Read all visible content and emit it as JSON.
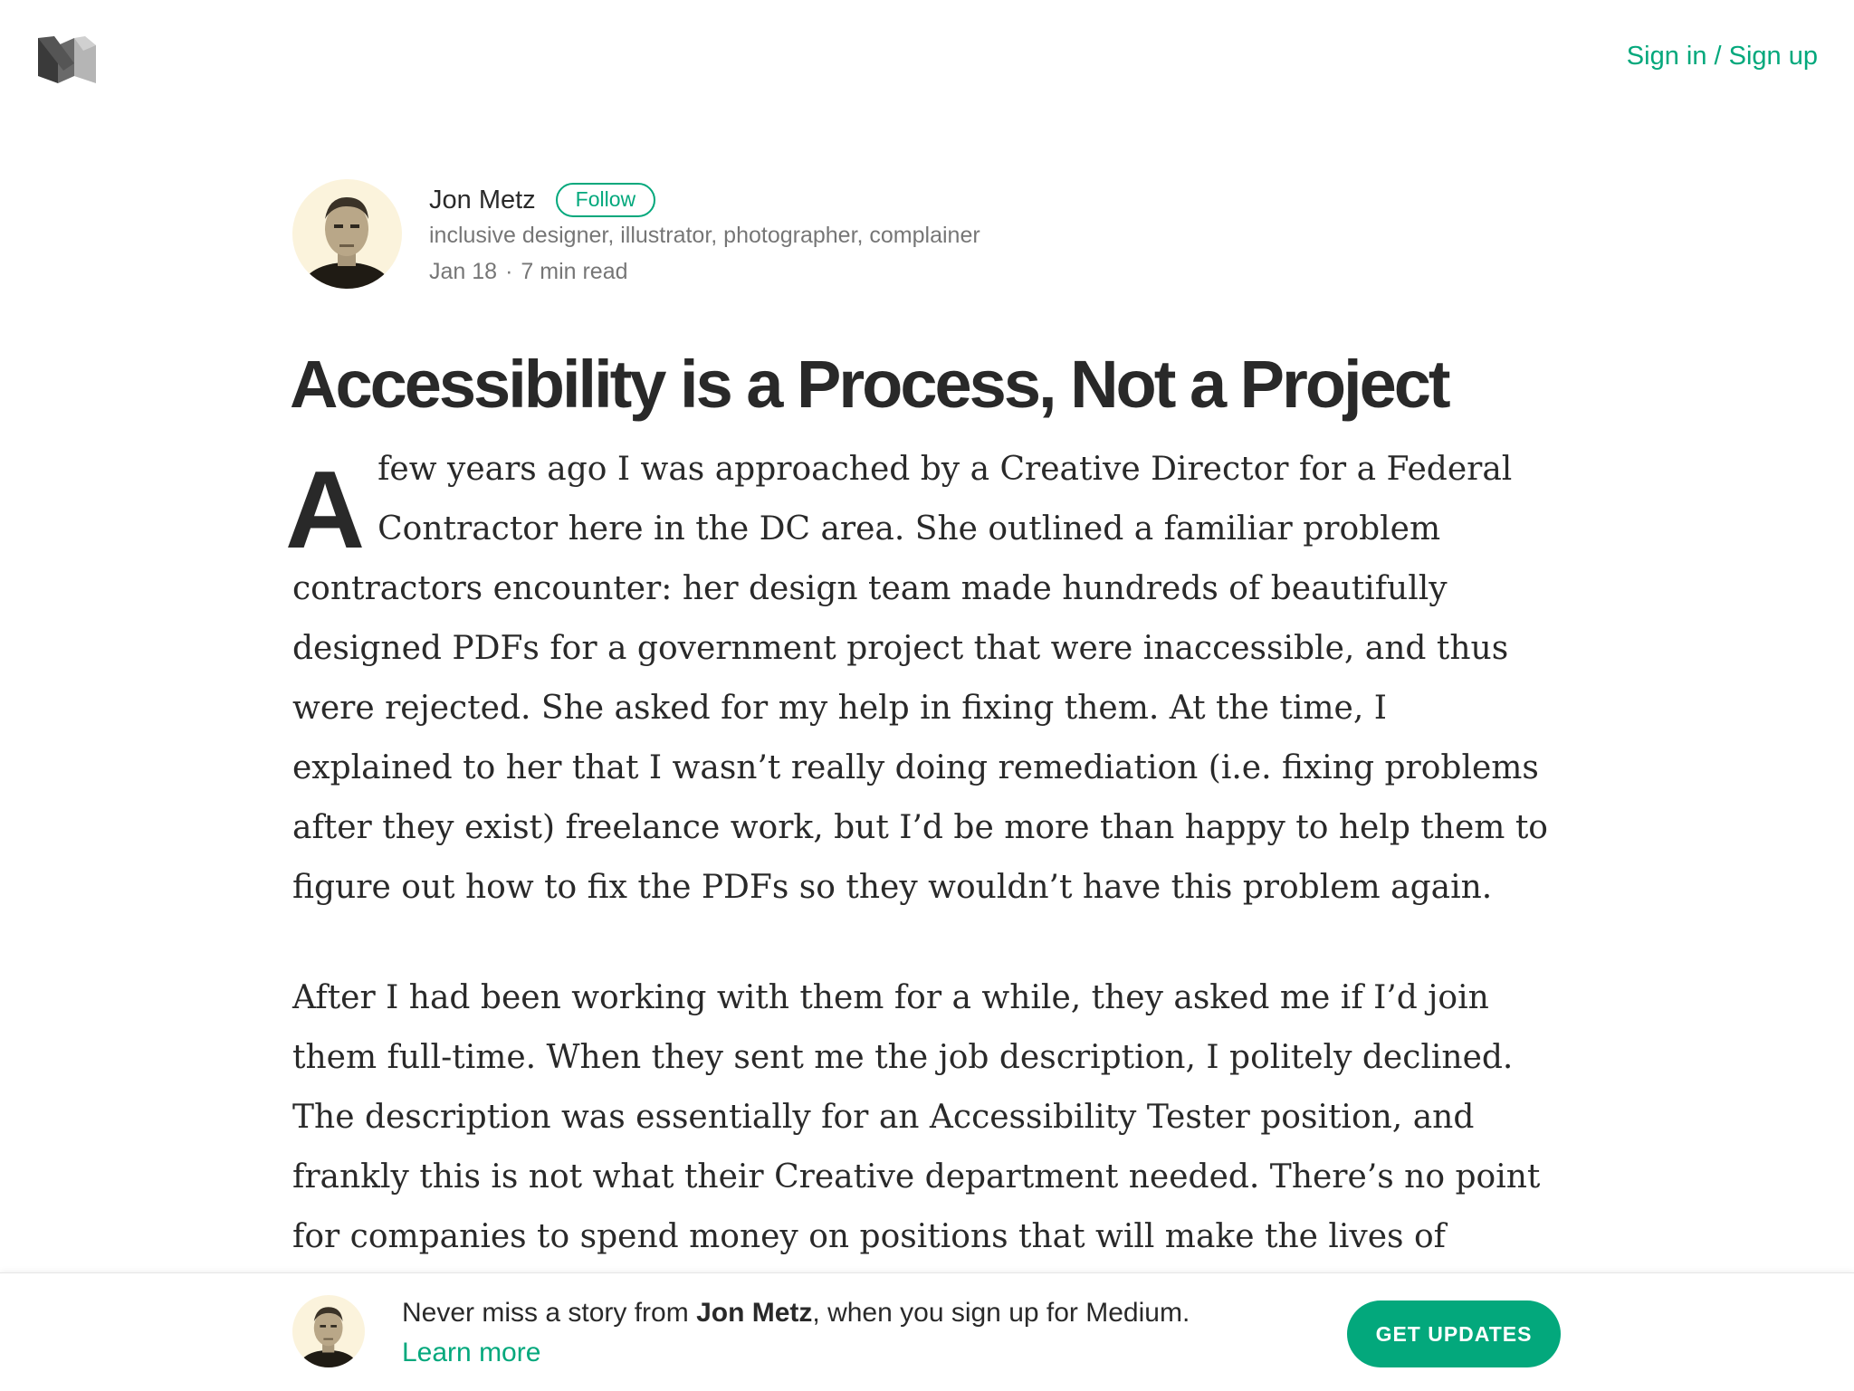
{
  "header": {
    "logo_icon": "medium-logo-icon",
    "auth_link": "Sign in / Sign up"
  },
  "author": {
    "name": "Jon Metz",
    "follow_label": "Follow",
    "bio": "inclusive designer, illustrator, photographer, complainer",
    "date": "Jan 18",
    "separator": "·",
    "read_time": "7 min read"
  },
  "article": {
    "title": "Accessibility is a Process, Not a Project",
    "dropcap": "A",
    "paragraph1_rest": "few years ago I was approached by a Creative Director for a Federal Contractor here in the DC area. She outlined a familiar problem contractors encounter: her design team made hundreds of beautifully designed PDFs for a government project that were inaccessible, and thus were rejected. She asked for my help in fixing them. At the time, I explained to her that I wasn’t really doing remediation (i.e. fixing problems after they exist) freelance work, but I’d be more than happy to help them to figure out how to fix the PDFs so they wouldn’t have this problem again.",
    "paragraph2": "After I had been working with them for a while, they asked me if I’d join them full-time. When they sent me the job description, I politely declined. The description was essentially for an Accessibility Tester position, and frankly this is not what their Creative department needed. There’s no point for companies to spend money on positions that will make the lives of"
  },
  "bottom_bar": {
    "text_before": "Never miss a story from ",
    "author_name": "Jon Metz",
    "text_after": ", when you sign up for Medium. ",
    "learn_more": "Learn more",
    "cta_label": "GET UPDATES"
  },
  "colors": {
    "accent": "#03a87c",
    "text": "#292929",
    "muted": "#757575"
  }
}
